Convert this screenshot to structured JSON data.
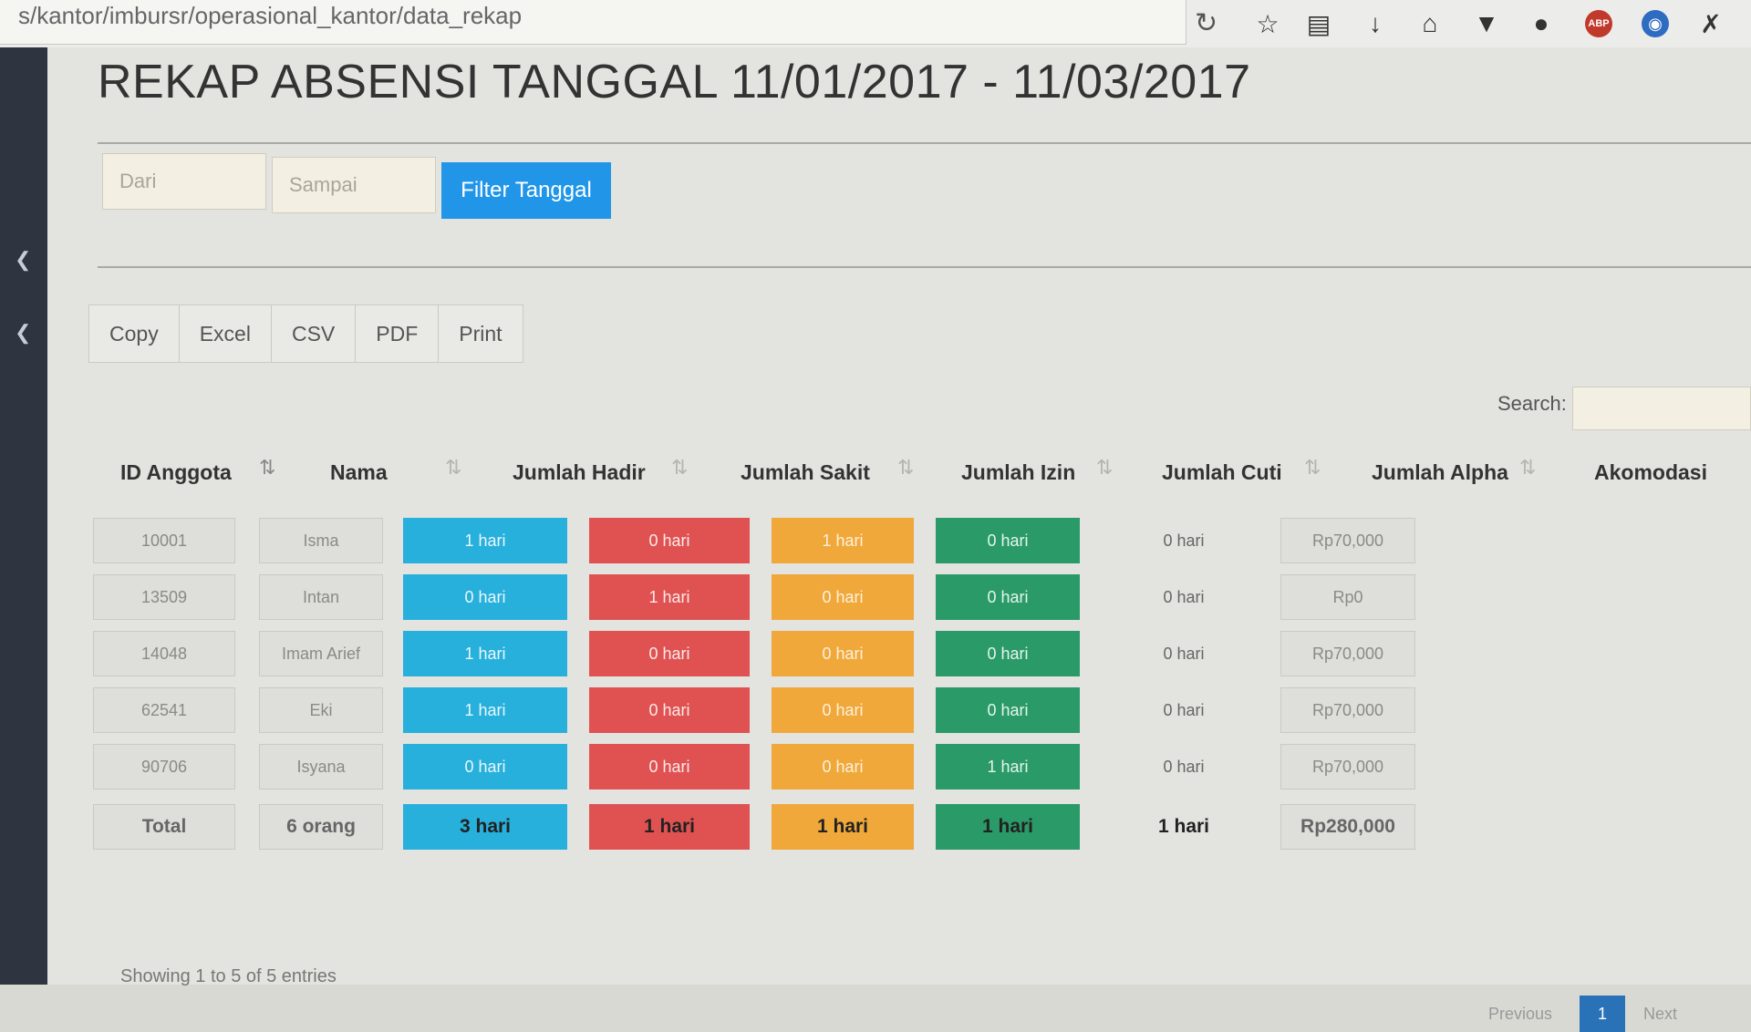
{
  "browser": {
    "url": "s/kantor/imbursr/operasional_kantor/data_rekap",
    "toolbar_icons": [
      "reload-icon",
      "bookmark-star-icon",
      "reading-list-icon",
      "download-icon",
      "home-icon",
      "pocket-icon",
      "profile-icon",
      "adblock-icon",
      "globe-icon",
      "tools-icon"
    ],
    "abp_label": "ABP"
  },
  "page": {
    "title": "REKAP ABSENSI TANGGAL 11/01/2017 - 11/03/2017"
  },
  "filter": {
    "from_placeholder": "Dari",
    "to_placeholder": "Sampai",
    "button": "Filter Tanggal"
  },
  "export_buttons": [
    "Copy",
    "Excel",
    "CSV",
    "PDF",
    "Print"
  ],
  "search": {
    "label": "Search:",
    "value": ""
  },
  "table": {
    "columns": [
      "ID Anggota",
      "Nama",
      "Jumlah Hadir",
      "Jumlah Sakit",
      "Jumlah Izin",
      "Jumlah Cuti",
      "Jumlah Alpha",
      "Akomodasi"
    ],
    "rows": [
      [
        "10001",
        "Isma",
        "1 hari",
        "0 hari",
        "1 hari",
        "0 hari",
        "0 hari",
        "Rp70,000"
      ],
      [
        "13509",
        "Intan",
        "0 hari",
        "1 hari",
        "0 hari",
        "0 hari",
        "0 hari",
        "Rp0"
      ],
      [
        "14048",
        "Imam Arief",
        "1 hari",
        "0 hari",
        "0 hari",
        "0 hari",
        "0 hari",
        "Rp70,000"
      ],
      [
        "62541",
        "Eki",
        "1 hari",
        "0 hari",
        "0 hari",
        "0 hari",
        "0 hari",
        "Rp70,000"
      ],
      [
        "90706",
        "Isyana",
        "0 hari",
        "0 hari",
        "0 hari",
        "1 hari",
        "0 hari",
        "Rp70,000"
      ]
    ],
    "total": [
      "Total",
      "6 orang",
      "3 hari",
      "1 hari",
      "1 hari",
      "1 hari",
      "1 hari",
      "Rp280,000"
    ]
  },
  "footer": {
    "info": "Showing 1 to 5 of 5 entries",
    "previous": "Previous",
    "current_page": "1",
    "next": "Next"
  },
  "colors": {
    "hadir": "#27b0dc",
    "sakit": "#e05252",
    "izin": "#f0a83a",
    "cuti": "#2a9a68",
    "primary_button": "#2196e8"
  }
}
